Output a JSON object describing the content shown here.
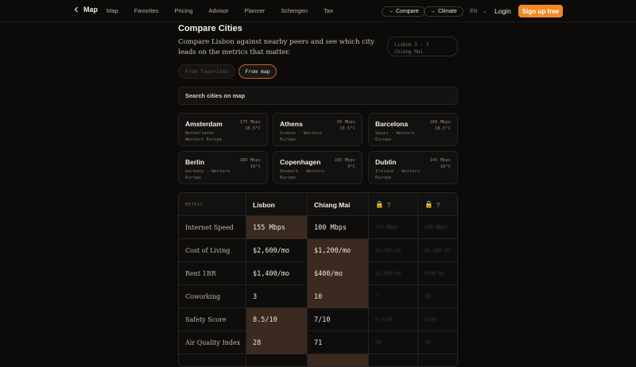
{
  "nav": {
    "back_label": "Map",
    "links": [
      "Map",
      "Favorites",
      "Pricing",
      "Advisor",
      "Planner",
      "Schengen",
      "Tax"
    ],
    "compare_label": "Compare",
    "climate_label": "Climate",
    "lang": "EN",
    "login_label": "Login",
    "signup_label": "Sign up free"
  },
  "header": {
    "title": "Compare Cities",
    "description": "Compare Lisbon against nearby peers and see which city leads on the metrics that matter.",
    "pair_line1": "Lisbon 3 · 3",
    "pair_line2": "Chiang Mai"
  },
  "toggles": {
    "favorites": "From favorites",
    "map": "From map"
  },
  "search": {
    "placeholder": "Search cities on map"
  },
  "cities": [
    {
      "name": "Amsterdam",
      "region": "Netherlands · Western Europe",
      "speed": "175 Mbps",
      "temp": "10.5°C"
    },
    {
      "name": "Athens",
      "region": "Greece · Western Europe",
      "speed": "95 Mbps",
      "temp": "18.5°C"
    },
    {
      "name": "Barcelona",
      "region": "Spain · Western Europe",
      "speed": "160 Mbps",
      "temp": "18.5°C"
    },
    {
      "name": "Berlin",
      "region": "Germany · Western Europe",
      "speed": "180 Mbps",
      "temp": "10°C"
    },
    {
      "name": "Copenhagen",
      "region": "Denmark · Western Europe",
      "speed": "165 Mbps",
      "temp": "9°C"
    },
    {
      "name": "Dublin",
      "region": "Ireland · Western Europe",
      "speed": "145 Mbps",
      "temp": "10°C"
    }
  ],
  "table": {
    "metric_header": "METRIC",
    "col1": "Lisbon",
    "col2": "Chiang Mai",
    "col3": "? ",
    "col4": "? ",
    "rows": [
      {
        "metric": "Internet Speed",
        "v1": "155 Mbps",
        "v2": "100 Mbps",
        "v3": "175 Mbps",
        "v4": "120 Mbps"
      },
      {
        "metric": "Cost of Living",
        "v1": "$2,600/mo",
        "v2": "$1,200/mo",
        "v3": "$1,500 mo",
        "v4": "$1,100 mo"
      },
      {
        "metric": "Rent 1BR",
        "v1": "$1,400/mo",
        "v2": "$400/mo",
        "v3": "$1,800 mo",
        "v4": "$500 mo"
      },
      {
        "metric": "Coworking",
        "v1": "3",
        "v2": "10",
        "v3": "7",
        "v4": "10"
      },
      {
        "metric": "Safety Score",
        "v1": "8.5/10",
        "v2": "7/10",
        "v3": "6.5/10",
        "v4": "8/10"
      },
      {
        "metric": "Air Quality Index",
        "v1": "28",
        "v2": "71",
        "v3": "30",
        "v4": "76"
      }
    ]
  },
  "colors": {
    "accent": "#f08a24",
    "win_cell": "#3a2a1f",
    "background": "#0c0b0a"
  }
}
